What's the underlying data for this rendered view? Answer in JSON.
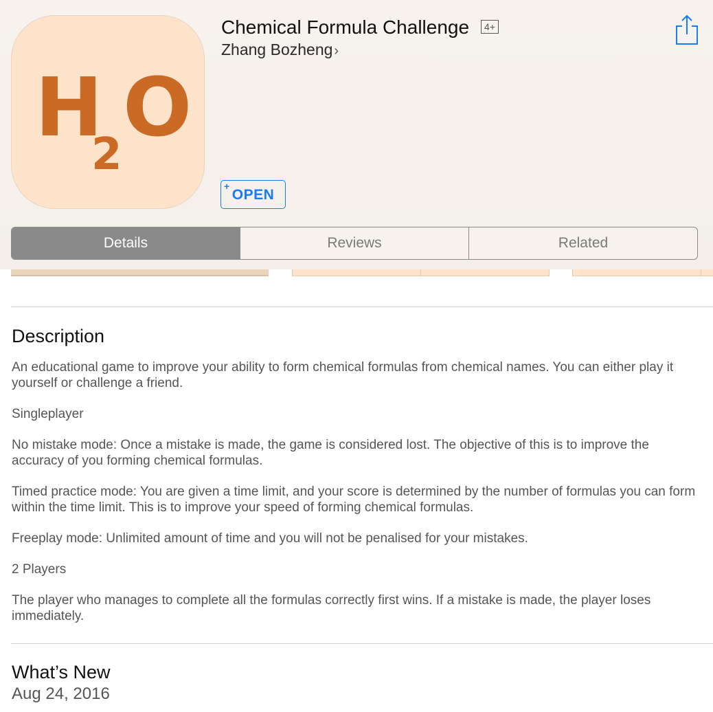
{
  "app": {
    "title": "Chemical Formula Challenge",
    "age_rating": "4+",
    "developer": "Zhang Bozheng",
    "icon": {
      "name": "app-icon",
      "text_main_left": "H",
      "text_sub": "2",
      "text_main_right": "O",
      "background": "#fde3ca",
      "glyph_color": "#cb6a25"
    },
    "open_label": "OPEN",
    "open_plus": "+",
    "share_icon": "share-icon"
  },
  "tabs": [
    {
      "label": "Details",
      "selected": true
    },
    {
      "label": "Reviews",
      "selected": false
    },
    {
      "label": "Related",
      "selected": false
    }
  ],
  "description": {
    "heading": "Description",
    "paragraphs": [
      "An educational game to improve your ability to form chemical formulas from chemical names. You can either play it yourself or challenge a friend.",
      "Singleplayer",
      "No mistake mode: Once a mistake is made, the game is considered lost. The objective of this is to improve the accuracy of you forming chemical formulas.",
      "Timed practice mode: You are given a time limit, and your score is determined by the number of formulas you can form within the time limit. This is to improve your speed of forming chemical formulas.",
      "Freeplay mode: Unlimited amount of time and you will not be penalised for your mistakes.",
      "2 Players",
      "The player who manages to complete all the formulas correctly first wins. If a mistake is made, the player loses immediately."
    ]
  },
  "whats_new": {
    "heading": "What’s New",
    "date": "Aug 24, 2016"
  },
  "colors": {
    "accent": "#1a7cf4",
    "segment_selected": "#8a8a8a"
  }
}
